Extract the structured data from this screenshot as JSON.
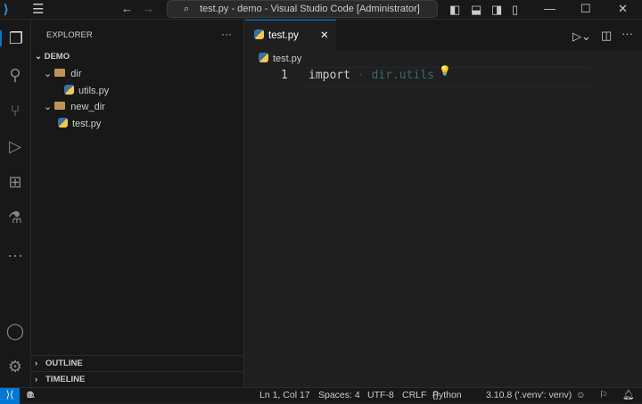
{
  "titlebar": {
    "title": "test.py - demo - Visual Studio Code [Administrator]"
  },
  "sidebar": {
    "title": "EXPLORER",
    "more": "···",
    "root": "DEMO",
    "tree": [
      {
        "label": "dir",
        "type": "folder"
      },
      {
        "label": "utils.py",
        "type": "file"
      },
      {
        "label": "new_dir",
        "type": "folder"
      },
      {
        "label": "test.py",
        "type": "file"
      }
    ],
    "panels": [
      "OUTLINE",
      "TIMELINE"
    ]
  },
  "editor": {
    "tab": "test.py",
    "breadcrumb": "test.py",
    "line_number": "1",
    "code_keyword": "import",
    "code_module": "dir.utils"
  },
  "status": {
    "errors": "0",
    "warnings": "0",
    "position": "Ln 1, Col 17",
    "spaces": "Spaces: 4",
    "encoding": "UTF-8",
    "eol": "CRLF",
    "language": "Python",
    "interpreter": "3.10.8 ('.venv': venv)"
  }
}
